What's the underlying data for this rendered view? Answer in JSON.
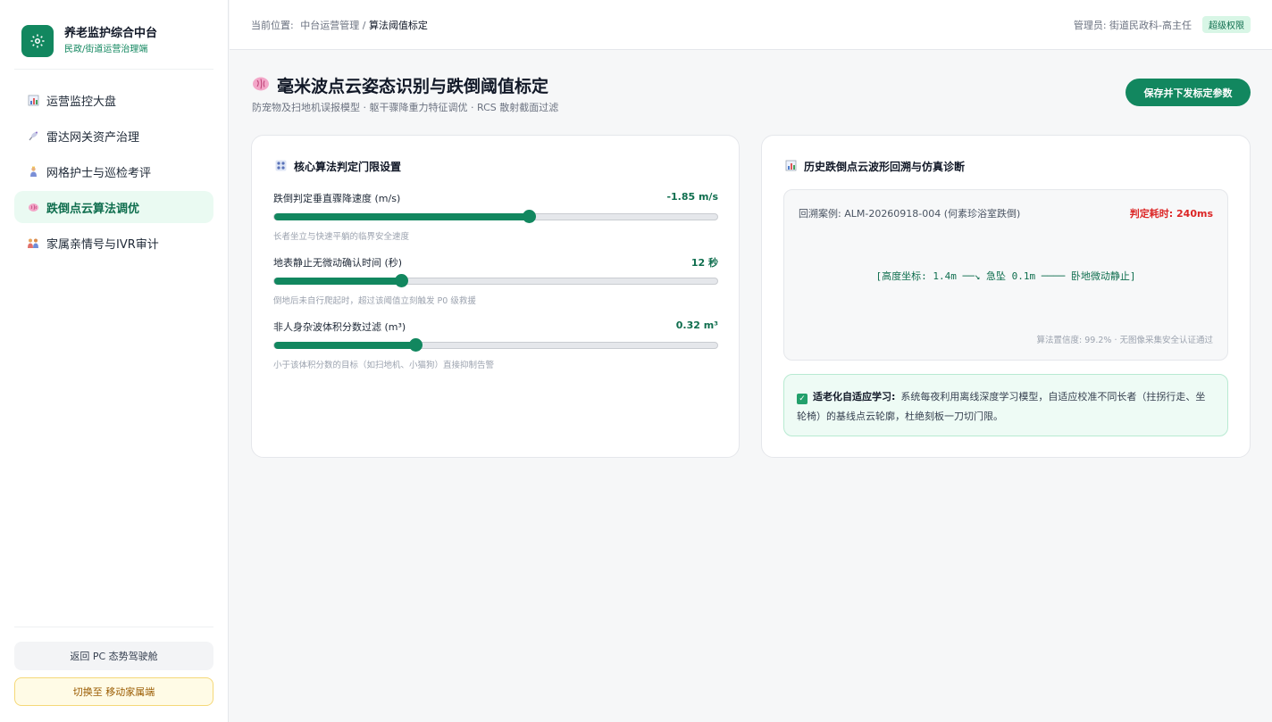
{
  "brand": {
    "title": "养老监护综合中台",
    "subtitle": "民政/街道运营治理端",
    "icon": "gear-icon"
  },
  "sidebar": {
    "items": [
      {
        "label": "运营监控大盘",
        "icon": "bar-chart-icon",
        "active": false
      },
      {
        "label": "雷达网关资产治理",
        "icon": "satellite-dish-icon",
        "active": false
      },
      {
        "label": "网格护士与巡检考评",
        "icon": "nurse-icon",
        "active": false
      },
      {
        "label": "跌倒点云算法调优",
        "icon": "brain-icon",
        "active": true
      },
      {
        "label": "家属亲情号与IVR审计",
        "icon": "family-icon",
        "active": false
      }
    ],
    "back_pc_label": "返回 PC 态势驾驶舱",
    "switch_mobile_label": "切换至 移动家属端"
  },
  "header": {
    "breadcrumb_prefix": "当前位置:",
    "breadcrumb_parent": "中台运营管理",
    "breadcrumb_sep": "/",
    "breadcrumb_current": "算法阈值标定",
    "admin_label": "管理员: 街道民政科-高主任",
    "badge": "超级权限"
  },
  "main": {
    "title": "毫米波点云姿态识别与跌倒阈值标定",
    "subtitle": "防宠物及扫地机误报模型 · 躯干骤降重力特征调优 · RCS 散射截面过滤",
    "save_label": "保存并下发标定参数"
  },
  "left_card": {
    "title": "核心算法判定门限设置",
    "sliders": [
      {
        "label": "跌倒判定垂直骤降速度 (m/s)",
        "value_text": "-1.85 m/s",
        "fraction": 0.575,
        "desc": "长者坐立与快速平躺的临界安全速度"
      },
      {
        "label": "地表静止无微动确认时间 (秒)",
        "value_text": "12 秒",
        "fraction": 0.287,
        "desc": "倒地后未自行爬起时，超过该阈值立刻触发 P0 级救援"
      },
      {
        "label": "非人身杂波体积分数过滤 (m³)",
        "value_text": "0.32 m³",
        "fraction": 0.318,
        "desc": "小于该体积分数的目标（如扫地机、小猫狗）直接抑制告警"
      }
    ]
  },
  "right_card": {
    "title": "历史跌倒点云波形回溯与仿真诊断",
    "case": "回溯案例: ALM-20260918-004 (何素珍浴室跌倒)",
    "time": "判定耗时: 240ms",
    "wave": "[高度坐标: 1.4m ──↘ 急坠 0.1m ──── 卧地微动静止]",
    "confidence": "算法置信度: 99.2% · 无图像采集安全认证通过",
    "note_lead": "适老化自适应学习:",
    "note_text": "系统每夜利用离线深度学习模型，自适应校准不同长者（拄拐行走、坐轮椅）的基线点云轮廓，杜绝刻板一刀切门限。"
  },
  "colors": {
    "accent": "#12875f",
    "accent_light": "#eafaf2",
    "danger": "#dc2626",
    "warning_bg": "#fffbe6"
  }
}
